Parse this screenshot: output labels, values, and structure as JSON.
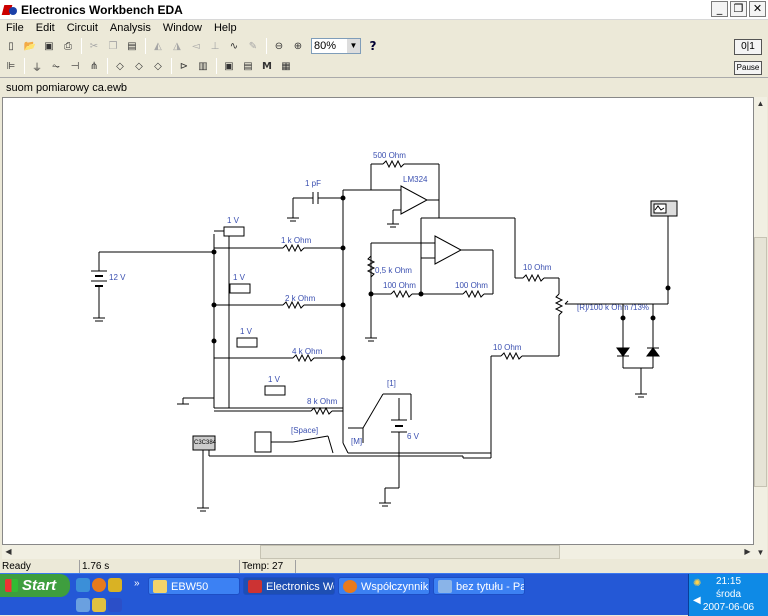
{
  "window": {
    "title": "Electronics Workbench EDA",
    "buttons": [
      "_",
      "❐",
      "✕"
    ]
  },
  "menu": [
    "File",
    "Edit",
    "Circuit",
    "Analysis",
    "Window",
    "Help"
  ],
  "toolbar": {
    "zoom": "80%",
    "help": "?"
  },
  "instruments": {
    "pause": "Pause"
  },
  "document": {
    "title": "suom pomiarowy ca.ewb"
  },
  "circuit": {
    "labels": {
      "r500": "500 Ohm",
      "opamp1": "LM324",
      "cap": "1 pF",
      "vm1": "1 V",
      "vm2": "1 V",
      "vm3": "1 V",
      "vm4": "1 V",
      "r1k": "1 k Ohm",
      "r2k": "2 k Ohm",
      "r4k": "4 k Ohm",
      "r8k": "8 k Ohm",
      "battery": "12 V",
      "r05k": "0,5 k Ohm",
      "r100a": "100 Ohm",
      "r100b": "100 Ohm",
      "r10a": "10 Ohm",
      "r10b": "10 Ohm",
      "pot": "[R]/100 k Ohm /13%",
      "key1": "[1]",
      "source6v": "6 V",
      "space": "[Space]",
      "keym": "[M]",
      "chip": "C3C384"
    }
  },
  "status": {
    "ready": "Ready",
    "time": "1.76 s",
    "temp": "Temp:  27"
  },
  "taskbar": {
    "start": "Start",
    "tasks": [
      "EBW50",
      "Electronics Wor...",
      "Współczynnik tł...",
      "bez tytułu - Paint"
    ],
    "clock": "21:15",
    "day": "środa",
    "date": "2007-06-06"
  },
  "colors": {
    "canvas": "#ffffff",
    "labels": "#3a4fb0",
    "taskbar": "#2458d6",
    "start": "#3e9e3e"
  }
}
